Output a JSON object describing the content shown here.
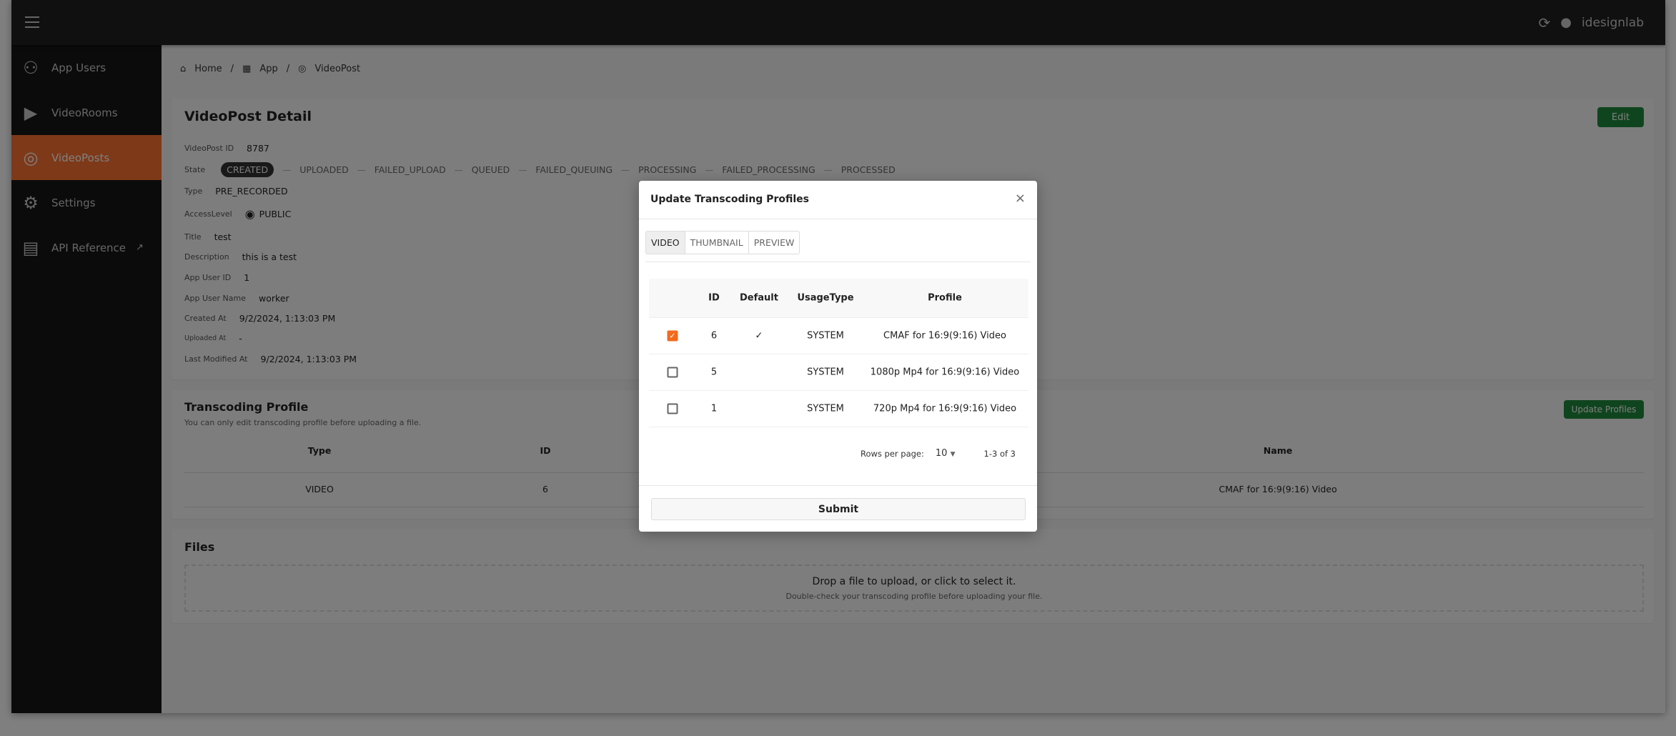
{
  "topbar": {
    "user": "idesignlab"
  },
  "sidebar": {
    "items": [
      {
        "label": "App Users",
        "icon": "person-icon"
      },
      {
        "label": "VideoRooms",
        "icon": "tv-icon"
      },
      {
        "label": "VideoPosts",
        "icon": "video-post-icon",
        "active": true
      },
      {
        "label": "Settings",
        "icon": "gear-icon"
      },
      {
        "label": "API Reference",
        "icon": "book-icon",
        "external": true
      }
    ]
  },
  "breadcrumb": [
    "Home",
    "App",
    "VideoPost"
  ],
  "detail": {
    "title": "VideoPost Detail",
    "edit_label": "Edit",
    "fields": {
      "id": {
        "label": "VideoPost ID",
        "value": "8787"
      },
      "state": {
        "label": "State",
        "current": "CREATED",
        "steps": [
          "UPLOADED",
          "FAILED_UPLOAD",
          "QUEUED",
          "FAILED_QUEUING",
          "PROCESSING",
          "FAILED_PROCESSING",
          "PROCESSED"
        ]
      },
      "type": {
        "label": "Type",
        "value": "PRE_RECORDED"
      },
      "access": {
        "label": "AccessLevel",
        "value": "PUBLIC"
      },
      "title": {
        "label": "Title",
        "value": "test"
      },
      "description": {
        "label": "Description",
        "value": "this is a test"
      },
      "app_user_id": {
        "label": "App User ID",
        "value": "1"
      },
      "app_user_name": {
        "label": "App User Name",
        "value": "worker"
      },
      "created_at": {
        "label": "Created At",
        "value": "9/2/2024, 1:13:03 PM"
      },
      "uploaded_at": {
        "label": "Uploaded At",
        "value": "-"
      },
      "modified_at": {
        "label": "Last Modified At",
        "value": "9/2/2024, 1:13:03 PM"
      }
    }
  },
  "transcoding": {
    "title": "Transcoding Profile",
    "subtitle": "You can only edit transcoding profile before uploading a file.",
    "button": "Update Profiles",
    "headers": {
      "type": "Type",
      "id": "ID",
      "name": "Name"
    },
    "row": {
      "type": "VIDEO",
      "id": "6",
      "name": "CMAF for 16:9(9:16) Video"
    }
  },
  "files": {
    "title": "Files",
    "drop": "Drop a file to upload, or click to select it.",
    "hint": "Double-check your transcoding profile before uploading your file."
  },
  "modal": {
    "title": "Update Transcoding Profiles",
    "tabs": [
      "VIDEO",
      "THUMBNAIL",
      "PREVIEW"
    ],
    "headers": {
      "id": "ID",
      "default": "Default",
      "usage": "UsageType",
      "profile": "Profile"
    },
    "rows": [
      {
        "checked": true,
        "id": "6",
        "default": "✓",
        "usage": "SYSTEM",
        "profile": "CMAF for 16:9(9:16) Video"
      },
      {
        "checked": false,
        "id": "5",
        "default": "",
        "usage": "SYSTEM",
        "profile": "1080p Mp4 for 16:9(9:16) Video"
      },
      {
        "checked": false,
        "id": "1",
        "default": "",
        "usage": "SYSTEM",
        "profile": "720p Mp4 for 16:9(9:16) Video"
      }
    ],
    "rows_per_page_label": "Rows per page:",
    "rows_per_page": "10",
    "range": "1-3 of 3",
    "submit": "Submit"
  },
  "colors": {
    "accent": "#f26b1d",
    "success": "#1f8a3c"
  }
}
